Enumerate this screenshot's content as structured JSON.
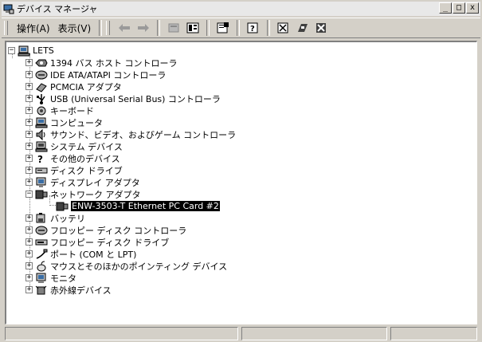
{
  "window": {
    "title": "デバイス マネージャ",
    "buttons": [
      "_",
      "□",
      "x"
    ]
  },
  "menu": {
    "items": [
      "操作(A)",
      "表示(V)"
    ]
  },
  "toolbar": {
    "buttons": [
      "back-icon",
      "forward-icon",
      "up-icon",
      "properties-view-icon",
      "properties-icon",
      "help-icon",
      "scan-hardware-icon",
      "print-icon",
      "uninstall-icon"
    ]
  },
  "tree": {
    "root": "LETS",
    "items": [
      {
        "label": "1394 バス ホスト コントローラ",
        "icon": "1394-bus-icon",
        "expander": "+"
      },
      {
        "label": "IDE ATA/ATAPI コントローラ",
        "icon": "ide-controller-icon",
        "expander": "+"
      },
      {
        "label": "PCMCIA アダプタ",
        "icon": "pcmcia-icon",
        "expander": "+"
      },
      {
        "label": "USB (Universal Serial Bus) コントローラ",
        "icon": "usb-icon",
        "expander": "+"
      },
      {
        "label": "キーボード",
        "icon": "keyboard-icon",
        "expander": "+"
      },
      {
        "label": "コンピュータ",
        "icon": "computer-icon",
        "expander": "+"
      },
      {
        "label": "サウンド、ビデオ、およびゲーム コントローラ",
        "icon": "sound-icon",
        "expander": "+"
      },
      {
        "label": "システム デバイス",
        "icon": "system-device-icon",
        "expander": "+"
      },
      {
        "label": "その他のデバイス",
        "icon": "other-device-icon",
        "expander": "+"
      },
      {
        "label": "ディスク ドライブ",
        "icon": "disk-drive-icon",
        "expander": "+"
      },
      {
        "label": "ディスプレイ アダプタ",
        "icon": "display-adapter-icon",
        "expander": "+"
      },
      {
        "label": "ネットワーク アダプタ",
        "icon": "network-adapter-icon",
        "expander": "−"
      },
      {
        "label": "ENW-3503-T Ethernet PC Card #2",
        "icon": "network-card-icon",
        "expander": "",
        "child": true,
        "selected": true
      },
      {
        "label": "バッテリ",
        "icon": "battery-icon",
        "expander": "+"
      },
      {
        "label": "フロッピー ディスク コントローラ",
        "icon": "floppy-controller-icon",
        "expander": "+"
      },
      {
        "label": "フロッピー ディスク ドライブ",
        "icon": "floppy-drive-icon",
        "expander": "+"
      },
      {
        "label": "ポート (COM と LPT)",
        "icon": "port-icon",
        "expander": "+"
      },
      {
        "label": "マウスとそのほかのポインティング デバイス",
        "icon": "mouse-icon",
        "expander": "+"
      },
      {
        "label": "モニタ",
        "icon": "monitor-icon",
        "expander": "+"
      },
      {
        "label": "赤外線デバイス",
        "icon": "infrared-icon",
        "expander": "+"
      }
    ]
  },
  "status": {
    "cells": [
      "",
      "",
      ""
    ]
  }
}
